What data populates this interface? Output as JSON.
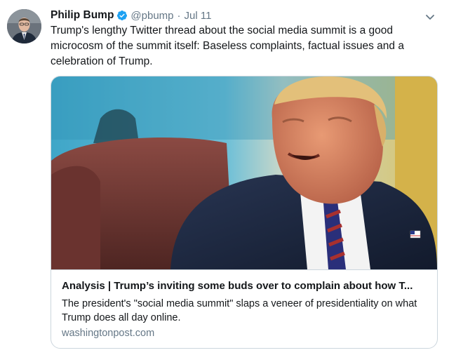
{
  "tweet": {
    "author_name": "Philip Bump",
    "handle": "@pbump",
    "separator": "·",
    "time": "Jul 11",
    "text": "Trump's lengthy Twitter thread about the social media summit is a good microcosm of the summit itself: Baseless complaints, factual issues and a celebration of Trump."
  },
  "card": {
    "title": "Analysis | Trump’s inviting some buds over to complain about how T...",
    "description": "The president's \"social media summit\" slaps a veneer of presidentiality on what Trump does all day online.",
    "domain": "washingtonpost.com"
  },
  "colors": {
    "text": "#14171a",
    "secondary": "#657786",
    "verified": "#1da1f2",
    "border": "#ccd6dd"
  },
  "icons": {
    "verified": "verified-badge-icon",
    "caret": "chevron-down-icon"
  }
}
